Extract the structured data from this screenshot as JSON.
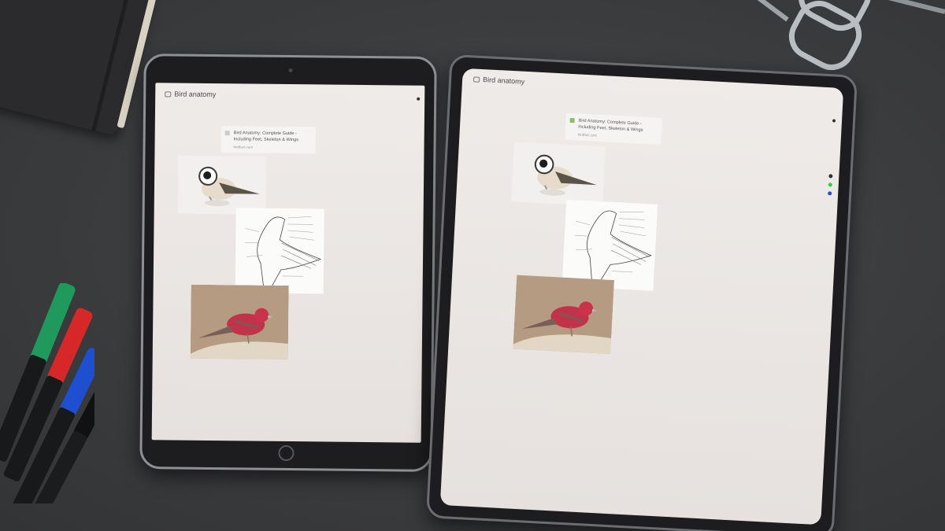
{
  "board": {
    "title": "Bird anatomy",
    "link_title": "Bird Anatomy: Complete Guide - Including Feet, Skeleton & Wings",
    "link_domain": "birdfact.com"
  },
  "colors": {
    "desk": "#3d3e40",
    "screen": "#ece8e5",
    "finch_red": "#c2334a",
    "tool_green": "#2ecc40",
    "tool_blue": "#2050d0"
  },
  "icons": {
    "board": "board-icon",
    "link": "link-favicon-icon",
    "home": "home-button-icon"
  }
}
